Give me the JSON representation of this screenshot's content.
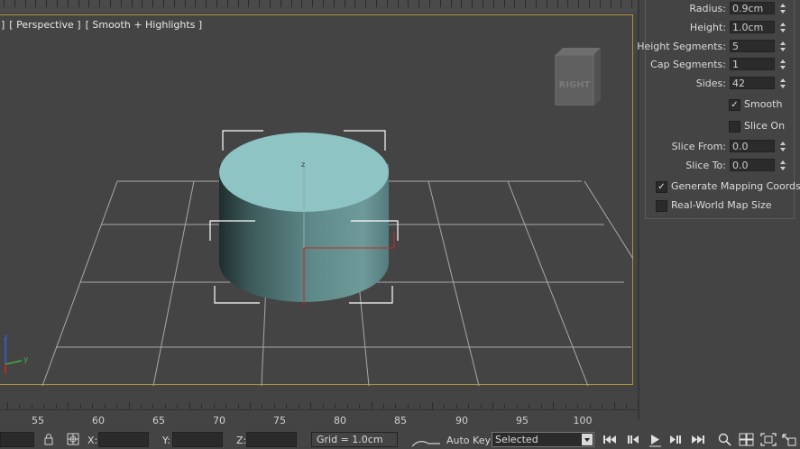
{
  "viewport": {
    "label_parts": [
      "]",
      "[ Perspective ]",
      "[ Smooth + Highlights ]"
    ],
    "viewcube_face": "RIGHT",
    "gizmo_label": "z",
    "axis_tripod": {
      "z": "z",
      "y": "y"
    }
  },
  "parameters": {
    "radius": {
      "label": "Radius:",
      "value": "0.9cm"
    },
    "height": {
      "label": "Height:",
      "value": "1.0cm"
    },
    "height_segments": {
      "label": "Height Segments:",
      "value": "5"
    },
    "cap_segments": {
      "label": "Cap Segments:",
      "value": "1"
    },
    "sides": {
      "label": "Sides:",
      "value": "42"
    },
    "smooth": {
      "label": "Smooth",
      "checked": true,
      "mark": "✓"
    },
    "slice_on": {
      "label": "Slice On",
      "checked": false
    },
    "slice_from": {
      "label": "Slice From:",
      "value": "0.0"
    },
    "slice_to": {
      "label": "Slice To:",
      "value": "0.0"
    },
    "gen_mapping": {
      "label": "Generate Mapping Coords.",
      "checked": true,
      "mark": "✓"
    },
    "real_world": {
      "label": "Real-World Map Size",
      "checked": false
    }
  },
  "timeline": {
    "ticks": [
      "55",
      "60",
      "65",
      "70",
      "75",
      "80",
      "85",
      "90",
      "95",
      "100"
    ]
  },
  "status_bar": {
    "x_label": "X:",
    "y_label": "Y:",
    "z_label": "Z:",
    "x_value": "",
    "y_value": "",
    "z_value": "",
    "grid": "Grid = 1.0cm",
    "auto_key": "Auto Key",
    "selected": "Selected",
    "icons": [
      "lock-icon",
      "absolute-mode-icon",
      "go-to-start-icon",
      "previous-frame-icon",
      "play-icon",
      "next-frame-icon",
      "go-to-end-icon",
      "zoom-icon",
      "zoom-all-icon",
      "zoom-extents-icon",
      "maximize-viewport-icon"
    ]
  },
  "colors": {
    "viewport_border": "#b3913a",
    "cylinder_top": "#8ec4c4",
    "cylinder_side": "#4f7474",
    "grid_lines": "#a9a9a9",
    "axis_red": "#c62828"
  }
}
